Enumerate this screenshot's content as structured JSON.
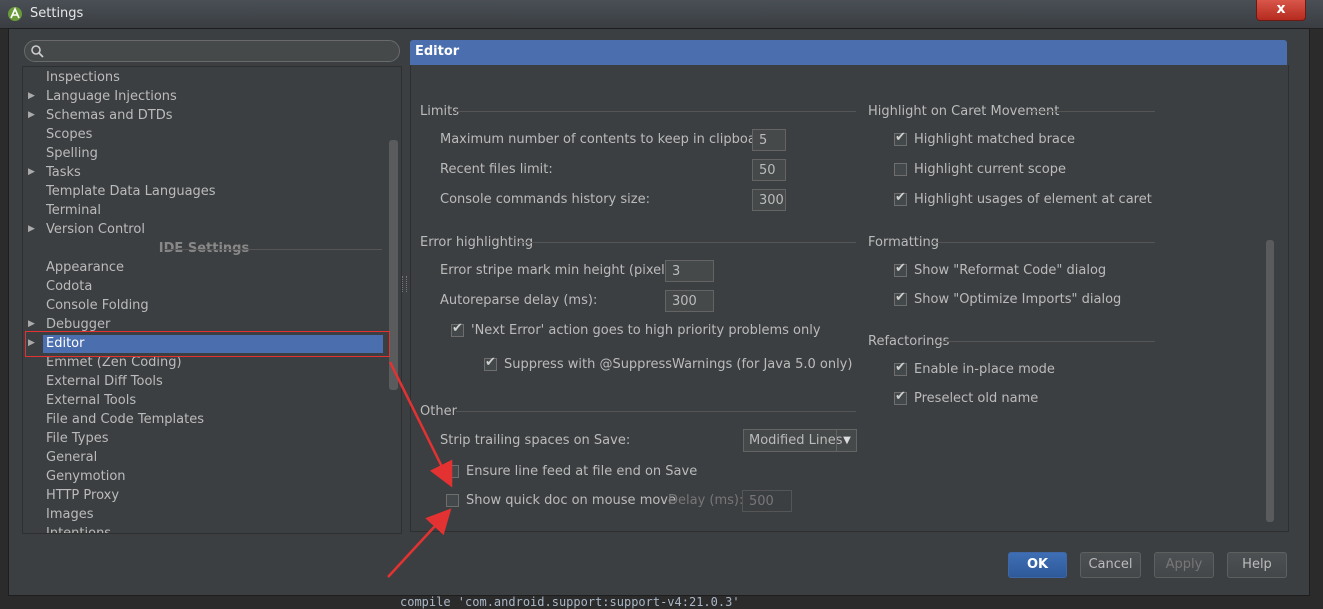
{
  "window": {
    "title": "Settings",
    "close_label": "x"
  },
  "background": {
    "code_line": "compile 'com.android.support:support-v4:21.0.3'"
  },
  "search": {
    "placeholder": ""
  },
  "tree": {
    "items_top": [
      {
        "label": "Inspections",
        "expandable": false
      },
      {
        "label": "Language Injections",
        "expandable": true
      },
      {
        "label": "Schemas and DTDs",
        "expandable": true
      },
      {
        "label": "Scopes",
        "expandable": false
      },
      {
        "label": "Spelling",
        "expandable": false
      },
      {
        "label": "Tasks",
        "expandable": true
      },
      {
        "label": "Template Data Languages",
        "expandable": false
      },
      {
        "label": "Terminal",
        "expandable": false
      },
      {
        "label": "Version Control",
        "expandable": true
      }
    ],
    "section_header": "IDE Settings",
    "items_ide": [
      {
        "label": "Appearance",
        "expandable": false
      },
      {
        "label": "Codota",
        "expandable": false
      },
      {
        "label": "Console Folding",
        "expandable": false
      },
      {
        "label": "Debugger",
        "expandable": true
      },
      {
        "label": "Editor",
        "expandable": true,
        "selected": true
      },
      {
        "label": "Emmet (Zen Coding)",
        "expandable": false
      },
      {
        "label": "External Diff Tools",
        "expandable": false
      },
      {
        "label": "External Tools",
        "expandable": false
      },
      {
        "label": "File and Code Templates",
        "expandable": false
      },
      {
        "label": "File Types",
        "expandable": false
      },
      {
        "label": "General",
        "expandable": false
      },
      {
        "label": "Genymotion",
        "expandable": false
      },
      {
        "label": "HTTP Proxy",
        "expandable": false
      },
      {
        "label": "Images",
        "expandable": false
      },
      {
        "label": "Intentions",
        "expandable": false
      }
    ]
  },
  "panel": {
    "title": "Editor",
    "limits": {
      "title": "Limits",
      "clipboard_label": "Maximum number of contents to keep in clipboard:",
      "clipboard_value": "5",
      "recent_label": "Recent files limit:",
      "recent_value": "50",
      "console_label": "Console commands history size:",
      "console_value": "300"
    },
    "error": {
      "title": "Error highlighting",
      "stripe_label": "Error stripe mark min height (pixels):",
      "stripe_value": "3",
      "autoreparse_label": "Autoreparse delay (ms):",
      "autoreparse_value": "300",
      "next_error_label": "'Next Error' action goes to high priority problems only",
      "next_error_checked": true,
      "suppress_label": "Suppress with @SuppressWarnings (for Java 5.0 only)",
      "suppress_checked": true
    },
    "other": {
      "title": "Other",
      "strip_label": "Strip trailing spaces on Save:",
      "strip_value": "Modified Lines",
      "line_feed_label": "Ensure line feed at file end on Save",
      "line_feed_checked": false,
      "quick_doc_label": "Show quick doc on mouse move",
      "quick_doc_checked": false,
      "delay_label": "Delay (ms):",
      "delay_value": "500"
    },
    "caret": {
      "title": "Highlight on Caret Movement",
      "matched_brace_label": "Highlight matched brace",
      "matched_brace_checked": true,
      "current_scope_label": "Highlight current scope",
      "current_scope_checked": false,
      "usages_label": "Highlight usages of element at caret",
      "usages_checked": true
    },
    "formatting": {
      "title": "Formatting",
      "reformat_label": "Show \"Reformat Code\" dialog",
      "reformat_checked": true,
      "optimize_label": "Show \"Optimize Imports\" dialog",
      "optimize_checked": true
    },
    "refactorings": {
      "title": "Refactorings",
      "inplace_label": "Enable in-place mode",
      "inplace_checked": true,
      "preselect_label": "Preselect old name",
      "preselect_checked": true
    }
  },
  "buttons": {
    "ok": "OK",
    "cancel": "Cancel",
    "apply": "Apply",
    "help": "Help"
  },
  "colors": {
    "accent": "#4b6eaf",
    "annotation": "#e43232",
    "background": "#3c3f41"
  }
}
